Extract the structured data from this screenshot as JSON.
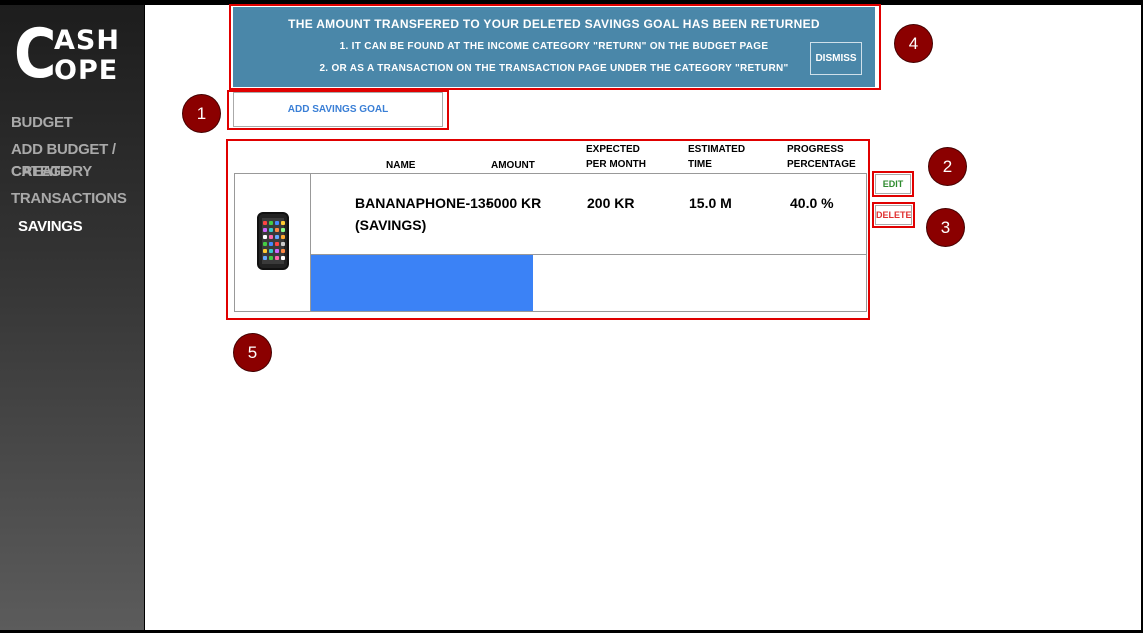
{
  "sidebar": {
    "logo": {
      "big_letter": "C",
      "line1": "ASH",
      "line2": "OPE"
    },
    "items": [
      {
        "label": "BUDGET"
      },
      {
        "label": "ADD BUDGET / CREATE"
      },
      {
        "label": "CATEGORY"
      },
      {
        "label": "TRANSACTIONS"
      },
      {
        "label": "SAVINGS"
      }
    ]
  },
  "notice": {
    "line1": "THE AMOUNT TRANSFERED TO YOUR DELETED SAVINGS GOAL HAS BEEN RETURNED",
    "line2": "1. IT CAN BE FOUND AT THE INCOME CATEGORY \"RETURN\" ON THE BUDGET PAGE",
    "line3": "2. OR AS A TRANSACTION ON THE TRANSACTION PAGE UNDER THE CATEGORY \"RETURN\"",
    "dismiss_label": "DISMISS",
    "color": "#4a87a9"
  },
  "add_savings_goal_label": "ADD SAVINGS GOAL",
  "table": {
    "headers": {
      "name": "NAME",
      "amount": "AMOUNT",
      "expected_line1": "EXPECTED",
      "expected_line2": "PER MONTH",
      "estimated_line1": "ESTIMATED",
      "estimated_line2": "TIME",
      "progress_line1": "PROGRESS",
      "progress_line2": "PERCENTAGE"
    },
    "row": {
      "icon": "mobile-phone-icon",
      "name_line1": "BANANAPHONE-13-",
      "name_line2": "(SAVINGS)",
      "amount": "5000 KR",
      "expected_per_month": "200 KR",
      "estimated_time": "15.0 M",
      "progress_percentage": "40.0 %",
      "progress_fraction": 0.4,
      "progress_color": "#3b82f6"
    }
  },
  "actions": {
    "edit_label": "EDIT",
    "delete_label": "DELETE"
  },
  "markers": [
    "1",
    "2",
    "3",
    "4",
    "5"
  ]
}
